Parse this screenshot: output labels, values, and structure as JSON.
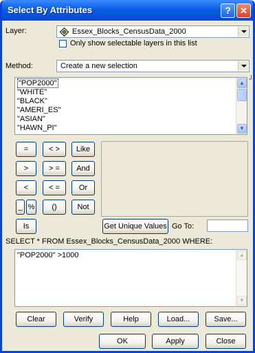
{
  "window": {
    "title": "Select By Attributes",
    "help_glyph": "?",
    "close_glyph": "✕"
  },
  "layer": {
    "label": "Layer:",
    "value": "Essex_Blocks_CensusData_2000",
    "icon": "layer-diamond-icon"
  },
  "selectable_only": {
    "label": "Only show selectable layers in this list",
    "checked": false
  },
  "method": {
    "label": "Method:",
    "value": "Create a new selection"
  },
  "fields": {
    "items": [
      "\"POP2000\"",
      "\"WHITE\"",
      "\"BLACK\"",
      "\"AMERI_ES\"",
      "\"ASIAN\"",
      "\"HAWN_PI\""
    ],
    "selected_index": 0
  },
  "operators": {
    "eq": "=",
    "neq": "< >",
    "like": "Like",
    "gt": ">",
    "gte": "> =",
    "and": "And",
    "lt": "<",
    "lte": "< =",
    "or": "Or",
    "underscore": "_",
    "percent": "%",
    "parens": "()",
    "not": "Not",
    "is": "Is"
  },
  "unique": {
    "button_label": "Get Unique Values",
    "goto_label": "Go To:",
    "goto_value": ""
  },
  "query": {
    "header": "SELECT * FROM Essex_Blocks_CensusData_2000 WHERE:",
    "expression": "\"POP2000\" >1000"
  },
  "actions": {
    "clear": "Clear",
    "verify": "Verify",
    "help": "Help",
    "load": "Load...",
    "save": "Save..."
  },
  "footer": {
    "ok": "OK",
    "apply": "Apply",
    "close": "Close"
  }
}
